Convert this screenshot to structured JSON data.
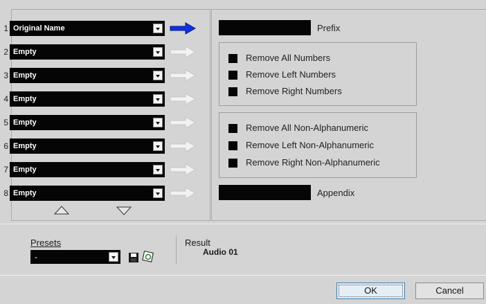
{
  "rows": [
    {
      "num": "1",
      "value": "Original Name",
      "active": true
    },
    {
      "num": "2",
      "value": "Empty",
      "active": false
    },
    {
      "num": "3",
      "value": "Empty",
      "active": false
    },
    {
      "num": "4",
      "value": "Empty",
      "active": false
    },
    {
      "num": "5",
      "value": "Empty",
      "active": false
    },
    {
      "num": "6",
      "value": "Empty",
      "active": false
    },
    {
      "num": "7",
      "value": "Empty",
      "active": false
    },
    {
      "num": "8",
      "value": "Empty",
      "active": false
    }
  ],
  "prefix": {
    "label": "Prefix",
    "value": ""
  },
  "appendix": {
    "label": "Appendix",
    "value": ""
  },
  "number_options": [
    {
      "label": "Remove All Numbers"
    },
    {
      "label": "Remove Left Numbers"
    },
    {
      "label": "Remove Right Numbers"
    }
  ],
  "nonalpha_options": [
    {
      "label": "Remove All Non-Alphanumeric"
    },
    {
      "label": "Remove Left Non-Alphanumeric"
    },
    {
      "label": "Remove Right Non-Alphanumeric"
    }
  ],
  "presets": {
    "label": "Presets",
    "value": "-"
  },
  "result": {
    "label": "Result",
    "value": "Audio 01"
  },
  "buttons": {
    "ok": "OK",
    "cancel": "Cancel"
  },
  "colors": {
    "active_arrow": "#1030e0",
    "inactive_arrow": "#f2f2f2",
    "field": "#050505"
  }
}
